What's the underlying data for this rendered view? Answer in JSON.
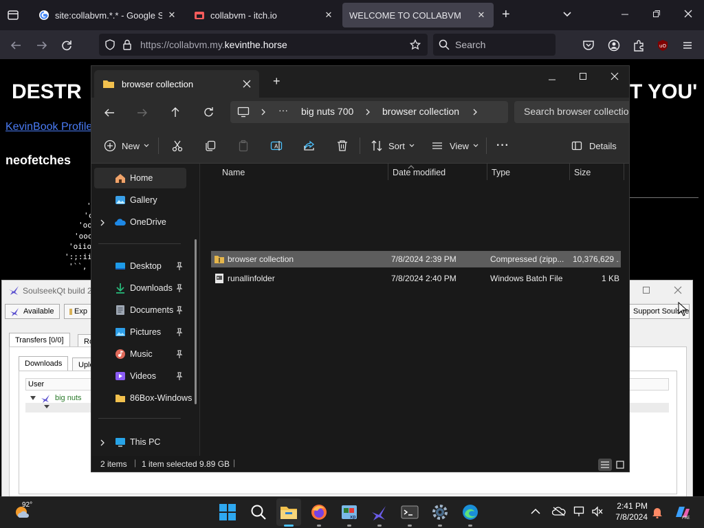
{
  "firefox": {
    "tabs": [
      {
        "title": "site:collabvm.*.* - Google Search",
        "close": "✕"
      },
      {
        "title": "collabvm - itch.io",
        "close": "✕"
      },
      {
        "title": "WELCOME TO COLLABVM",
        "close": "✕"
      }
    ],
    "new_tab": "+",
    "url_prefix": "https://collabvm.my.",
    "url_domain": "kevinthe.horse",
    "search_placeholder": "Search"
  },
  "remote_page": {
    "title_left": "DESTR",
    "title_right": "T YOU'",
    "link": "KevinBook Profile",
    "heading": "neofetches",
    "ascii_lines": [
      "'",
      "'c",
      "'oo",
      "'ooo",
      "'oiio",
      "':;:ii",
      "'``,"
    ]
  },
  "soulseek": {
    "title": "SoulseekQt build 2",
    "available_label": "Available",
    "expand_label": "Exp",
    "support_label": "Support Soulseek",
    "transfers_tab": "Transfers [0/0]",
    "rooms_tab": "Ro",
    "downloads_tab": "Downloads",
    "uploads_tab": "Uplo",
    "user_header": "User",
    "user_entry": "big nuts"
  },
  "explorer": {
    "tab_title": "browser collection",
    "new_tab": "+",
    "breadcrumb": [
      "big nuts 700",
      "browser collection"
    ],
    "search_placeholder": "Search browser collection",
    "toolbar": {
      "new": "New",
      "sort": "Sort",
      "view": "View",
      "details": "Details",
      "more": "···"
    },
    "nav_items": [
      {
        "label": "Home",
        "icon": "home-icon",
        "active": true
      },
      {
        "label": "Gallery",
        "icon": "gallery-icon"
      },
      {
        "label": "OneDrive",
        "icon": "onedrive-icon",
        "expandable": true
      },
      {
        "label": "Desktop",
        "icon": "desktop-icon",
        "pinned": true
      },
      {
        "label": "Downloads",
        "icon": "download-icon",
        "pinned": true
      },
      {
        "label": "Documents",
        "icon": "documents-icon",
        "pinned": true
      },
      {
        "label": "Pictures",
        "icon": "pictures-icon",
        "pinned": true
      },
      {
        "label": "Music",
        "icon": "music-icon",
        "pinned": true
      },
      {
        "label": "Videos",
        "icon": "videos-icon",
        "pinned": true
      },
      {
        "label": "86Box-Windows",
        "icon": "folder-icon"
      },
      {
        "label": "This PC",
        "icon": "this-pc-icon",
        "expandable": true
      }
    ],
    "columns": [
      "Name",
      "Date modified",
      "Type",
      "Size"
    ],
    "files": [
      {
        "name": "browser collection",
        "date": "7/8/2024 2:39 PM",
        "type": "Compressed (zipp...",
        "size": "10,376,629 ...",
        "selected": true,
        "icon": "zip-folder-icon"
      },
      {
        "name": "runallinfolder",
        "date": "7/8/2024 2:40 PM",
        "type": "Windows Batch File",
        "size": "1 KB",
        "selected": false,
        "icon": "batch-file-icon"
      }
    ],
    "status": {
      "items": "2 items",
      "selected": "1 item selected",
      "size": "9.89 GB"
    }
  },
  "taskbar": {
    "weather_temp": "92°",
    "time": "2:41 PM",
    "date": "7/8/2024"
  },
  "colors": {
    "firefox_tabbar": "#1c1b22",
    "firefox_navbar": "#2b2a33",
    "explorer_bg": "#191919",
    "selection": "#5d5d5d",
    "accent": "#4cc2ff",
    "link": "#4a7cf6"
  }
}
